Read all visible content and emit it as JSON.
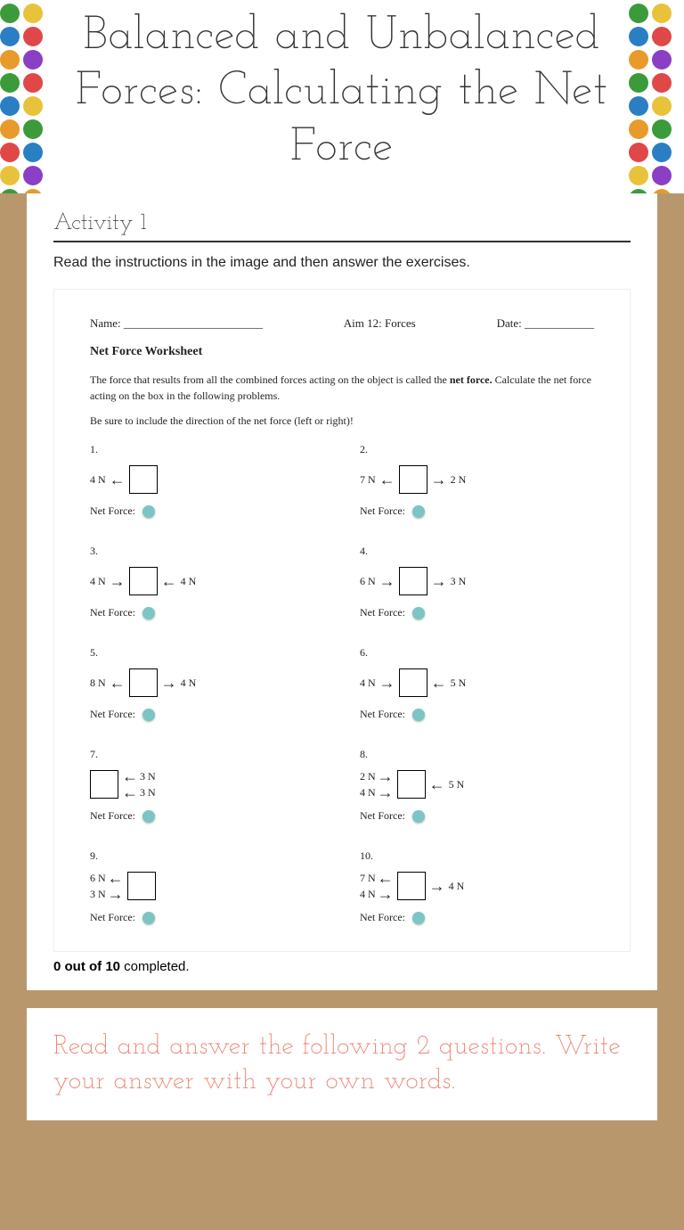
{
  "header": {
    "title": "Balanced and Unbalanced Forces: Calculating the Net Force"
  },
  "activity": {
    "label": "Activity 1",
    "instructions": "Read the instructions in the image and then answer the exercises."
  },
  "worksheet": {
    "name_label": "Name: ________________________",
    "aim": "Aim 12: Forces",
    "date_label": "Date: ____________",
    "title": "Net Force Worksheet",
    "intro1": "The force that results from all the combined forces acting on the object is called the ",
    "intro1b": "net force.",
    "intro1c": " Calculate the net force acting on the box in the following problems.",
    "intro2": "Be sure to include the direction of the net force (left or right)!",
    "nf_label": "Net Force:",
    "problems": [
      {
        "n": "1.",
        "left": "4 N",
        "larrow": "←",
        "rarrow": "",
        "right": ""
      },
      {
        "n": "2.",
        "left": "7 N",
        "larrow": "←",
        "rarrow": "→",
        "right": "2 N"
      },
      {
        "n": "3.",
        "left": "4 N",
        "larrow": "→",
        "rarrow": "←",
        "right": "4 N"
      },
      {
        "n": "4.",
        "left": "6 N",
        "larrow": "→",
        "rarrow": "→",
        "right": "3 N"
      },
      {
        "n": "5.",
        "left": "8 N",
        "larrow": "←",
        "rarrow": "→",
        "right": "4 N"
      },
      {
        "n": "6.",
        "left": "4 N",
        "larrow": "→",
        "rarrow": "←",
        "right": "5 N"
      },
      {
        "n": "7.",
        "stacked_right": [
          {
            "v": "3 N",
            "a": "←"
          },
          {
            "v": "3 N",
            "a": "←"
          }
        ]
      },
      {
        "n": "8.",
        "stacked_left": [
          {
            "v": "2 N",
            "a": "→"
          },
          {
            "v": "4 N",
            "a": "→"
          }
        ],
        "rarrow": "←",
        "right": "5 N"
      },
      {
        "n": "9.",
        "stacked_left": [
          {
            "v": "6 N",
            "a": "←"
          },
          {
            "v": "3 N",
            "a": "→"
          }
        ]
      },
      {
        "n": "10.",
        "stacked_left": [
          {
            "v": "7 N",
            "a": "←"
          },
          {
            "v": "4 N",
            "a": "→"
          }
        ],
        "rarrow": "→",
        "right": "4 N"
      }
    ]
  },
  "completion": {
    "done": "0",
    "total": "10",
    "suffix": " completed."
  },
  "section2": {
    "prompt": "Read and answer the following 2 questions. Write your answer with your own words."
  },
  "dot_colors": [
    "#3b9b3b",
    "#e8c23a",
    "#2a7fc4",
    "#e04848",
    "#e89a2a",
    "#8a3fc4",
    "#3b9b3b",
    "#e04848",
    "#2a7fc4",
    "#e8c23a",
    "#e89a2a",
    "#3b9b3b",
    "#e04848",
    "#2a7fc4",
    "#e8c23a",
    "#8a3fc4",
    "#3b9b3b",
    "#e89a2a",
    "#e04848",
    "#2a7fc4",
    "#e8c23a",
    "#3b9b3b",
    "#e04848",
    "#e89a2a"
  ]
}
